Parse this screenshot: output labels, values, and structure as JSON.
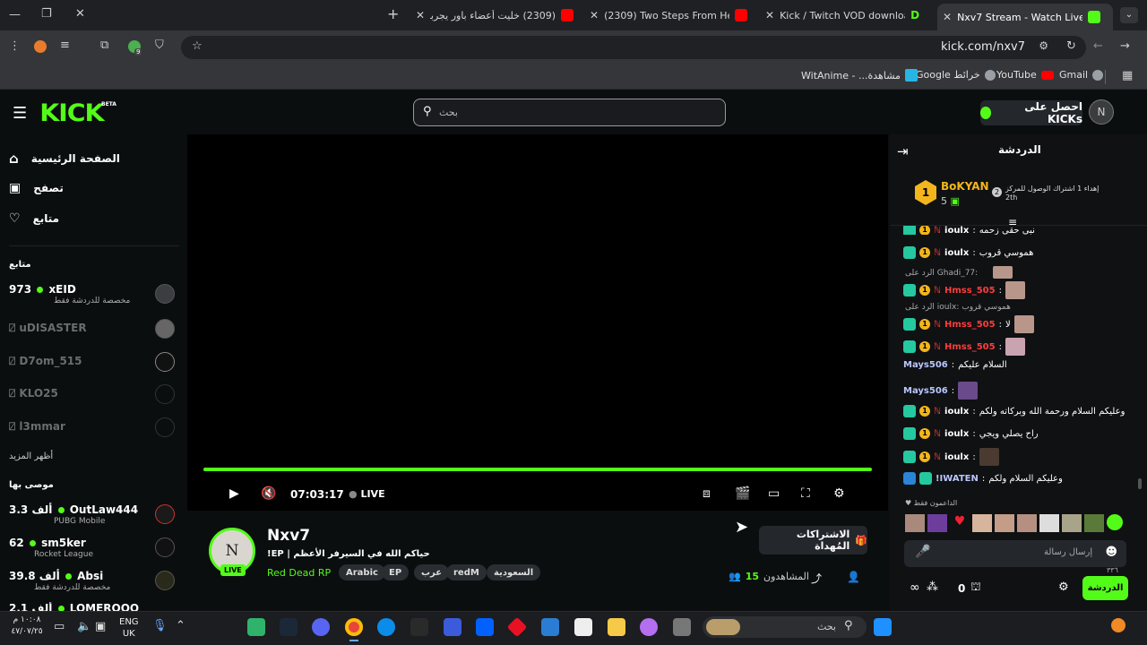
{
  "browser": {
    "tabs": [
      {
        "title": "Nxv7 Stream - Watch Live on Ki",
        "active": true
      },
      {
        "title": "Kick / Twitch VOD downloader"
      },
      {
        "title": "(2309) Two Steps From Hell - St"
      },
      {
        "title": "(2309) خليت أعضاء باور يجربون ا"
      }
    ],
    "new_tab": "+",
    "url": "kick.com/nxv7",
    "extension_count": "9",
    "bookmarks": [
      "Gmail",
      "YouTube",
      "خرائط Google",
      "مشاهدة... - WitAnime"
    ]
  },
  "header": {
    "logo": "KICK",
    "beta": "BETA",
    "search_placeholder": "بحث",
    "get_kicks": "احصل على KICKs"
  },
  "sidebar": {
    "nav": [
      {
        "label": "الصفحة الرئيسية",
        "icon": "home-icon"
      },
      {
        "label": "تصفح",
        "icon": "browse-icon"
      },
      {
        "label": "متابع",
        "icon": "heart-icon"
      }
    ],
    "following_heading": "متابع",
    "following": [
      {
        "name": "xEID",
        "viewers": "973",
        "sub": "مخصصة للدردشة فقط",
        "live": true
      },
      {
        "name": "uDISASTER",
        "live": false
      },
      {
        "name": "D7om_515",
        "live": false
      },
      {
        "name": "KLO25",
        "live": false
      },
      {
        "name": "l3mmar",
        "live": false
      }
    ],
    "show_more": "أظهر المزيد",
    "recommended_heading": "موصى بها",
    "recommended": [
      {
        "name": "OutLaw444",
        "viewers": "3.3 ألف",
        "sub": "PUBG Mobile"
      },
      {
        "name": "sm5ker",
        "viewers": "62",
        "sub": "Rocket League"
      },
      {
        "name": "Absi",
        "viewers": "39.8 ألف",
        "sub": "مخصصة للدردشة فقط"
      },
      {
        "name": "LOMEROOO",
        "viewers": "2.1 ألف",
        "sub": ""
      }
    ]
  },
  "player": {
    "time": "07:03:17",
    "live": "LIVE",
    "progress": 1.0
  },
  "stream": {
    "channel": "Nxv7",
    "live_badge": "LIVE",
    "title": "حياكم الله في السيرفر الأعظم | EP!",
    "category": "Red Dead RP",
    "tags": [
      "Arabic",
      "EP",
      "عرب",
      "redM",
      "السعودية"
    ],
    "gift_subs": "الاشتراكات المُهداة",
    "viewers_label": "المشاهدون",
    "viewers": "15"
  },
  "chat": {
    "title": "الدردشة",
    "pinned": {
      "user": "BoKYAN",
      "count": "5",
      "rank": "2",
      "text": "إهداء 1 اشتراك الوصول للمركز",
      "rank_text": "2th"
    },
    "messages": [
      {
        "user": "ioulx",
        "text": "نبي حقي زحمه",
        "color": "#ffffff"
      },
      {
        "user": "ioulx",
        "text": "هموسي قروب",
        "color": "#ffffff"
      },
      {
        "reply": "الرد على Ghadi_77:",
        "user": "Hmss_505",
        "text": "",
        "color": "#ff3c3c"
      },
      {
        "reply": "الرد على ioulx: هموسي قروب",
        "user": "Hmss_505",
        "text": "لا",
        "color": "#ff3c3c"
      },
      {
        "user": "Hmss_505",
        "text": "",
        "color": "#ff3c3c"
      },
      {
        "user": "Mays506",
        "text": "السلام عليكم",
        "color": "#b9c7ff"
      },
      {
        "user": "Mays506",
        "text": "",
        "color": "#b9c7ff"
      },
      {
        "user": "ioulx",
        "text": "وعليكم السلام ورحمة الله وبركاته ولكم",
        "color": "#ffffff"
      },
      {
        "user": "ioulx",
        "text": "راح يصلي ويجي",
        "color": "#ffffff"
      },
      {
        "user": "ioulx",
        "text": "",
        "color": "#ffffff"
      },
      {
        "user": "!IWATEN",
        "text": "وعليكم السلام ولكم",
        "color": "#b9c7ff"
      }
    ],
    "supporters_label": "الداعمون فقط",
    "input_placeholder": "إرسال رسالة",
    "kicks_count": "0",
    "send_button": "الدردشة",
    "char_count": "٣٣٦"
  },
  "taskbar": {
    "lang": "ENG",
    "region": "UK",
    "time": "١٠:٠٨ م",
    "date": "٤٧/٠٧/٢٥",
    "search_placeholder": "بحث"
  },
  "colors": {
    "accent": "#53fc18",
    "background": "#0b0e0f"
  }
}
